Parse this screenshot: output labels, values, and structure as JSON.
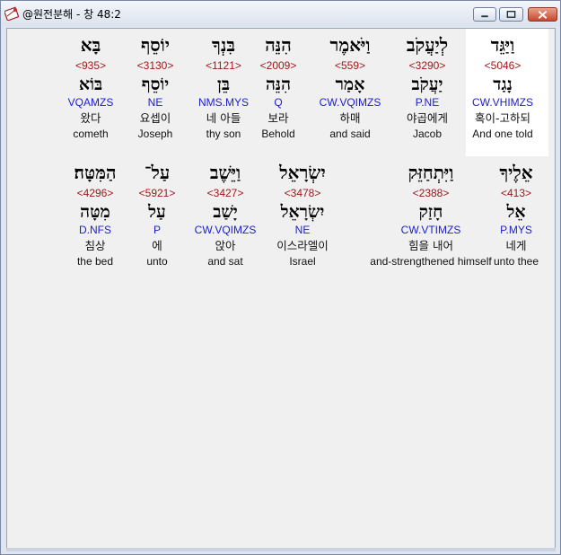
{
  "window": {
    "title": "@원전분해 - 창 48:2",
    "controls": [
      "minimize",
      "maximize",
      "close"
    ]
  },
  "rows": [
    [
      {
        "heb": "וַיַּגֵּד",
        "num": "<5046>",
        "root": "נָגַד",
        "morph": "CW.VHIMZS",
        "kor": "혹이-고하되",
        "eng": "And one told",
        "selected": true
      },
      {
        "heb": "לְיַעֲקֹב",
        "num": "<3290>",
        "root": "יַעֲקֹב",
        "morph": "P.NE",
        "kor": "야곱에게",
        "eng": "Jacob"
      },
      {
        "heb": "וַיֹּאמֶר",
        "num": "<559>",
        "root": "אָמַר",
        "morph": "CW.VQIMZS",
        "kor": "하매",
        "eng": "and said"
      },
      {
        "heb": "הִנֵּה",
        "num": "<2009>",
        "root": "הִנֵּה",
        "morph": "Q",
        "kor": "보라",
        "eng": "Behold"
      },
      {
        "heb": "בִּנְךָ",
        "num": "<1121>",
        "root": "בֵּן",
        "morph": "NMS.MYS",
        "kor": "네 아들",
        "eng": "thy son"
      },
      {
        "heb": "יוֹסֵף",
        "num": "<3130>",
        "root": "יוֹסֵף",
        "morph": "NE",
        "kor": "요셉이",
        "eng": "Joseph"
      },
      {
        "heb": "בָּא",
        "num": "<935>",
        "root": "בּוֹא",
        "morph": "VQAMZS",
        "kor": "왔다",
        "eng": "cometh"
      }
    ],
    [
      {
        "heb": "אֵלֶיךָ",
        "num": "<413>",
        "root": "אֵל",
        "morph": "P.MYS",
        "kor": "네게",
        "eng": "unto thee"
      },
      {
        "heb": "וַיִּתְחַזֵּק",
        "num": "<2388>",
        "root": "חָזַק",
        "morph": "CW.VTIMZS",
        "kor": "힘을 내어",
        "eng": "and-strengthened himself"
      },
      {
        "heb": "יִשְׂרָאֵל",
        "num": "<3478>",
        "root": "יִשְׂרָאֵל",
        "morph": "NE",
        "kor": "이스라엘이",
        "eng": "Israel"
      },
      {
        "heb": "וַיֵּשֶׁב",
        "num": "<3427>",
        "root": "יָשַׁב",
        "morph": "CW.VQIMZS",
        "kor": "앉아",
        "eng": "and sat"
      },
      {
        "heb": "עַל־",
        "num": "<5921>",
        "root": "עַל",
        "morph": "P",
        "kor": "에",
        "eng": "unto"
      },
      {
        "heb": "הַמִּטָּה׃",
        "num": "<4296>",
        "root": "מִטָּה",
        "morph": "D.NFS",
        "kor": "침상",
        "eng": "the bed"
      }
    ]
  ],
  "colors": {
    "strong_number": "#a01818",
    "morphology": "#1c1ccf",
    "selected_background": "#ffffff",
    "client_background": "#f0f0f0"
  },
  "icons": {
    "app": "bible-book-icon",
    "minimize": "minimize-icon",
    "maximize": "maximize-icon",
    "close": "close-icon"
  }
}
